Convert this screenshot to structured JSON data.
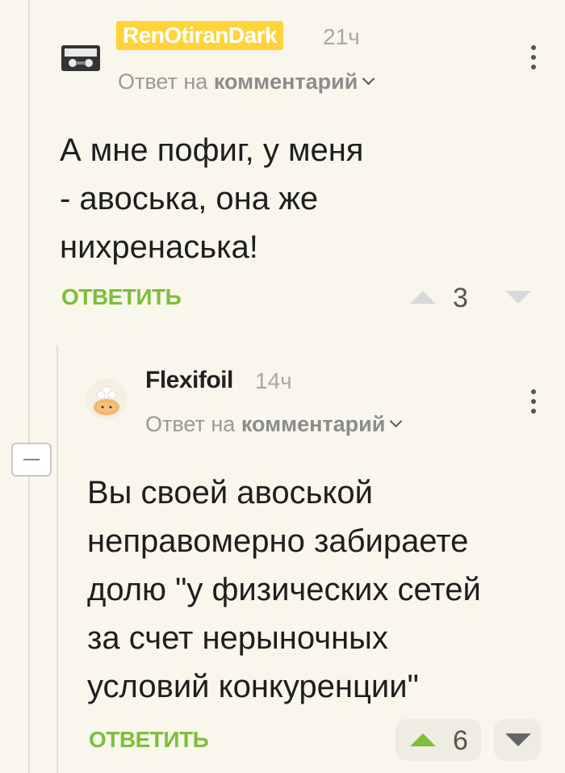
{
  "comments": [
    {
      "author": "RenOtiranDark",
      "time": "21ч",
      "reply_prefix": "Ответ на",
      "reply_target": "комментарий",
      "lines": [
        "А мне пофиг, у меня",
        "- авоська, она же",
        "нихренаська!"
      ],
      "reply_label": "ОТВЕТИТЬ",
      "votes": "3",
      "avatar_icon": "cassette-icon"
    },
    {
      "author": "Flexifoil",
      "time": "14ч",
      "reply_prefix": "Ответ на",
      "reply_target": "комментарий",
      "lines": [
        "Вы своей авоськой",
        "неправомерно забираете",
        "долю \"у физических сетей",
        "за счет нерыночных",
        "условий конкуренции\""
      ],
      "reply_label": "ОТВЕТИТЬ",
      "votes": "6",
      "avatar_icon": "chef-avatar-icon"
    }
  ],
  "colors": {
    "accent": "#7cbf3a",
    "badge": "#ffd43a",
    "background": "#f9f6ec"
  }
}
